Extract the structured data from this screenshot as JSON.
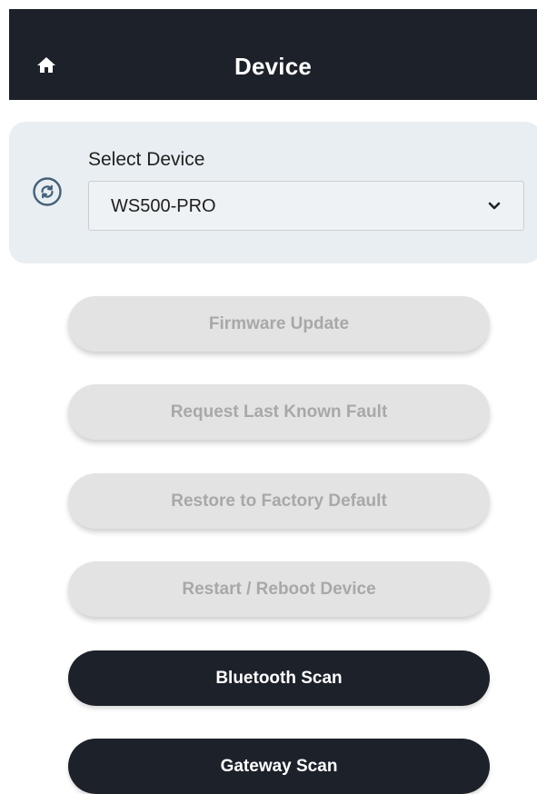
{
  "header": {
    "title": "Device",
    "home_icon": "home-icon",
    "background": "#1c212a"
  },
  "device_selector": {
    "label": "Select Device",
    "selected_value": "WS500-PRO",
    "refresh_icon": "sync-icon",
    "dropdown_icon": "chevron-down-icon",
    "panel_color": "#e9eef2"
  },
  "actions": [
    {
      "label": "Firmware Update",
      "enabled": false
    },
    {
      "label": "Request Last Known Fault",
      "enabled": false
    },
    {
      "label": "Restore to Factory Default",
      "enabled": false
    },
    {
      "label": "Restart / Reboot Device",
      "enabled": false
    },
    {
      "label": "Bluetooth Scan",
      "enabled": true
    },
    {
      "label": "Gateway Scan",
      "enabled": true
    }
  ],
  "colors": {
    "primary_button": "#1c212a",
    "disabled_button": "#e3e3e3",
    "disabled_text": "#a8a8a8"
  }
}
